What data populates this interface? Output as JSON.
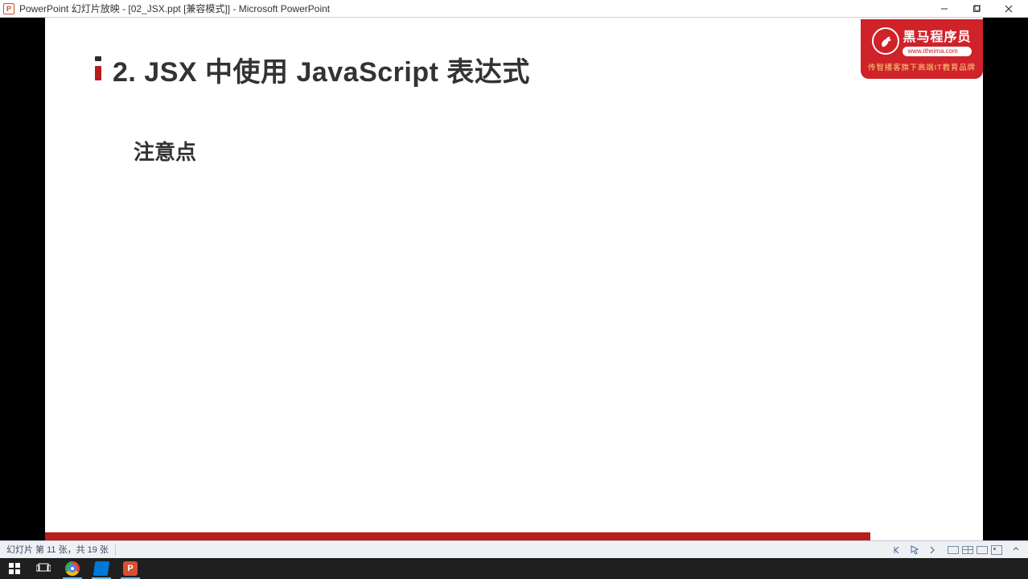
{
  "titlebar": {
    "app_icon_letter": "P",
    "title": "PowerPoint 幻灯片放映 - [02_JSX.ppt [兼容模式]] - Microsoft PowerPoint"
  },
  "slide": {
    "title": "2. JSX 中使用 JavaScript 表达式",
    "subtitle": "注意点",
    "brand": {
      "name": "黑马程序员",
      "url": "www.itheima.com",
      "slogan": "传智播客旗下高端IT教育品牌"
    }
  },
  "statusbar": {
    "text": "幻灯片 第 11 张，共 19 张"
  },
  "taskbar": {
    "items": [
      "windows-start",
      "task-view",
      "chrome",
      "vscode",
      "powerpoint"
    ]
  }
}
